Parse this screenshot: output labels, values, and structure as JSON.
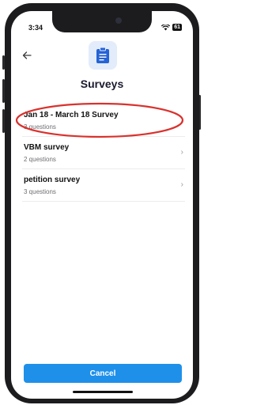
{
  "status_bar": {
    "time": "3:34",
    "battery": "61"
  },
  "header": {
    "back_icon": "arrow-left-icon",
    "title_icon": "clipboard-icon",
    "title": "Surveys"
  },
  "surveys": [
    {
      "name": "Jan 18 - March 18 Survey",
      "count": "3 questions"
    },
    {
      "name": "VBM survey",
      "count": "2 questions"
    },
    {
      "name": "petition survey",
      "count": "3 questions"
    }
  ],
  "annotation": {
    "color": "#d9322e",
    "shape": "ellipse around first survey item"
  },
  "footer": {
    "cancel_label": "Cancel"
  },
  "colors": {
    "accent": "#1e90ea",
    "title": "#1a1a2e",
    "icon_bg": "#e3ecfb"
  }
}
